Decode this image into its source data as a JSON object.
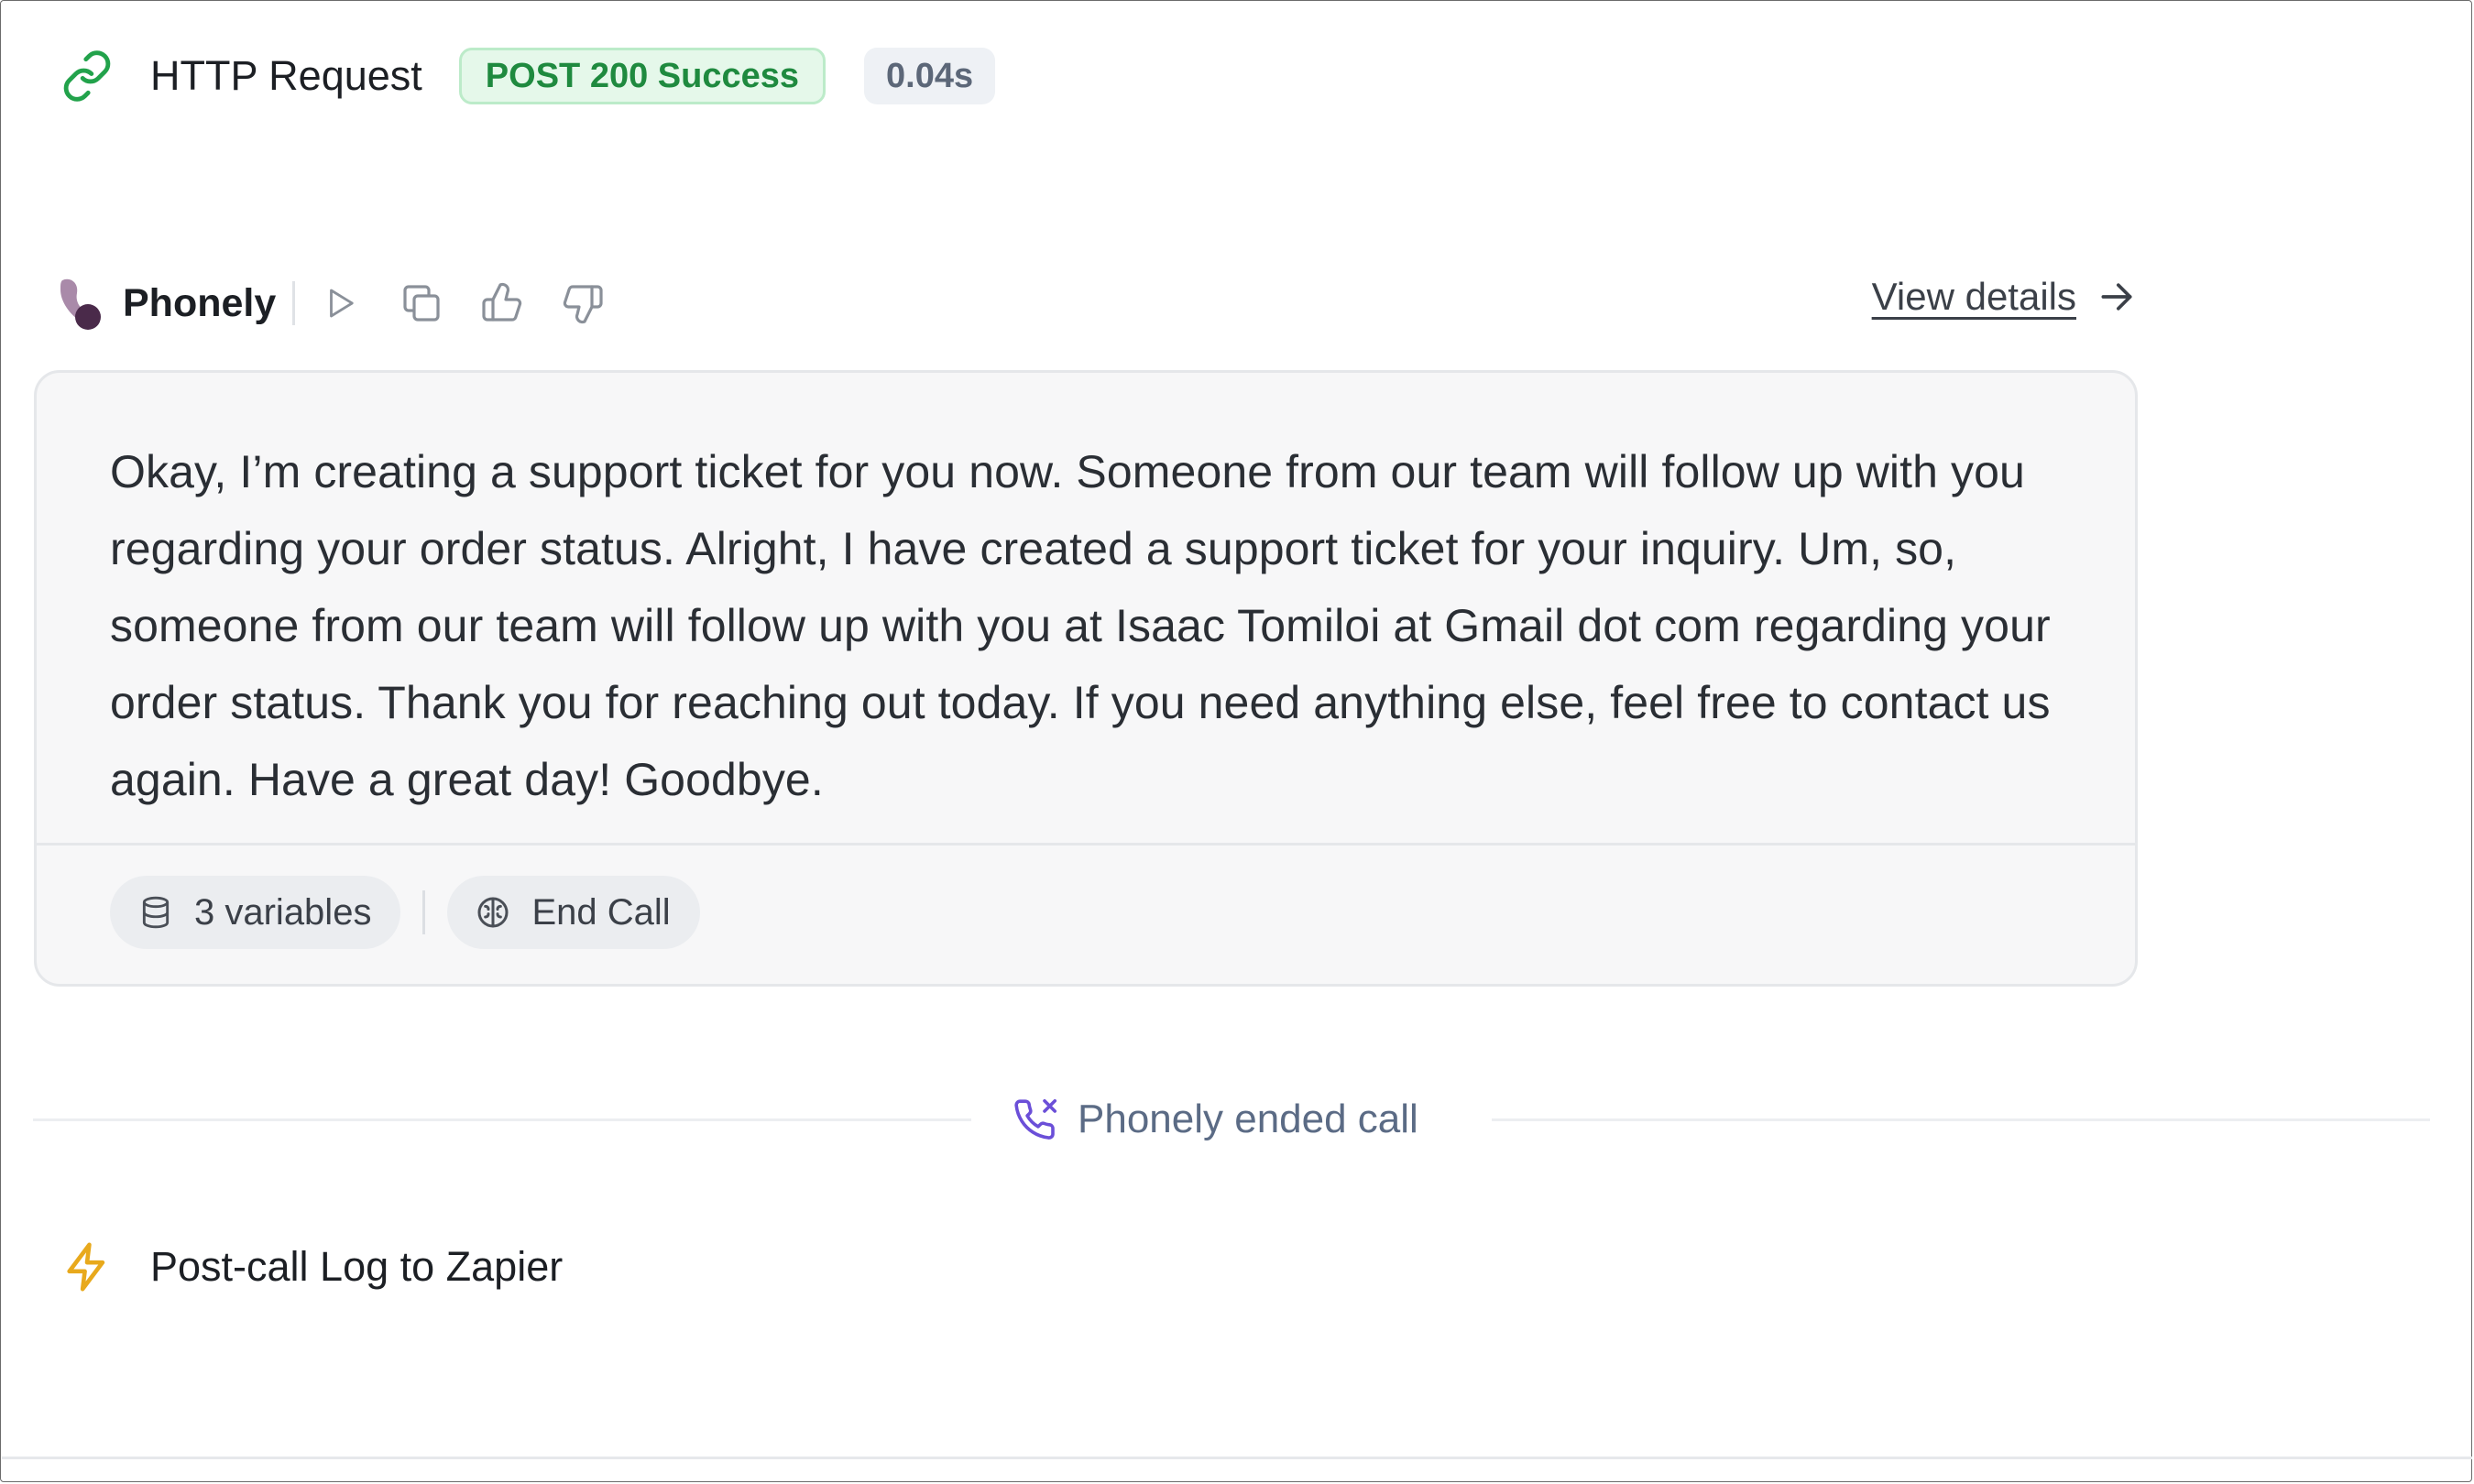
{
  "http_step": {
    "title": "HTTP Request",
    "status_badge": "POST 200 Success",
    "duration": "0.04s",
    "icon": "link-icon"
  },
  "message": {
    "agent_name": "Phonely",
    "toolbar_icons": [
      "play-icon",
      "copy-icon",
      "thumbs-up-icon",
      "thumbs-down-icon"
    ],
    "view_details_label": "View details",
    "text": "Okay, I’m creating a support ticket for you now. Someone from our team will follow up with you regarding your order status. Alright, I have created a support ticket for your inquiry. Um, so, someone from our team will follow up with you at Isaac Tomiloi at Gmail dot com regarding your order status. Thank you for reaching out today. If you need anything else, feel free to contact us again. Have a great day! Goodbye.",
    "chips": {
      "variables_label": "3 variables",
      "end_call_label": "End Call"
    }
  },
  "end_call": {
    "label": "Phonely ended call",
    "icon": "phone-off-icon"
  },
  "post_call_step": {
    "title": "Post-call Log to Zapier",
    "icon": "lightning-icon"
  },
  "colors": {
    "success_green": "#1f8a3f",
    "success_bg": "#e5f8ea",
    "accent_purple": "#6b4fd8",
    "bolt_yellow": "#e8a91c",
    "logo_dark": "#4a2a4a"
  }
}
